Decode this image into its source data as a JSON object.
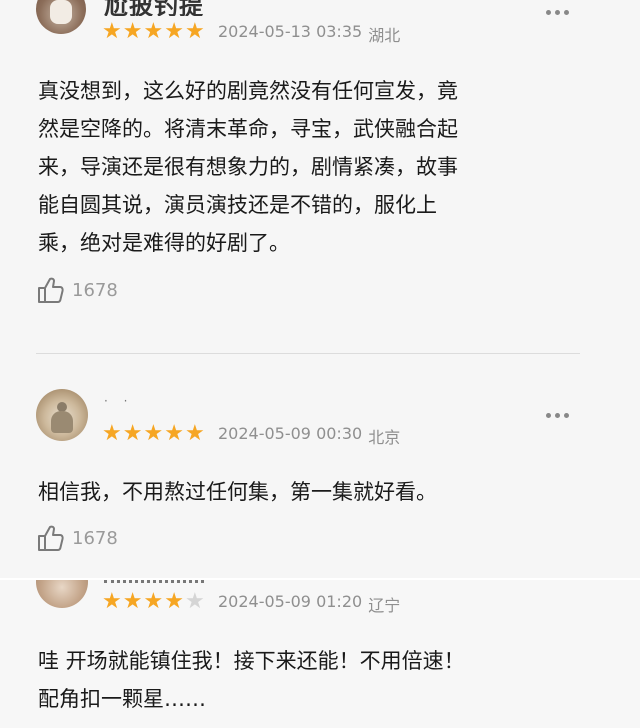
{
  "colors": {
    "star": "#f6a623",
    "star_empty": "#d5d5d5",
    "meta": "#8f8f8f"
  },
  "comments": [
    {
      "username": "尬披钓提",
      "rating": 5,
      "date": "2024-05-13 03:35",
      "location": "湖北",
      "text_lines": [
        "真没想到，这么好的剧竟然没有任何宣发，竟",
        "然是空降的。将清末革命，寻宝，武侠融合起",
        "来，导演还是很有想象力的，剧情紧凑，故事",
        "能自圆其说，演员演技还是不错的，服化上",
        "乘，绝对是难得的好剧了。"
      ],
      "likes": "1678"
    },
    {
      "username": "",
      "rating": 5,
      "date": "2024-05-09 00:30",
      "location": "北京",
      "text_lines": [
        "相信我，不用熬过任何集，第一集就好看。"
      ],
      "likes": "1678"
    },
    {
      "username": "",
      "rating": 4,
      "date": "2024-05-09 01:20",
      "location": "辽宁",
      "text_lines": [
        "哇 开场就能镇住我！接下来还能！不用倍速！",
        "配角扣一颗星……"
      ]
    }
  ],
  "icons": {
    "like": "thumb-up-icon",
    "more": "more-dots-icon",
    "star": "star-icon"
  }
}
